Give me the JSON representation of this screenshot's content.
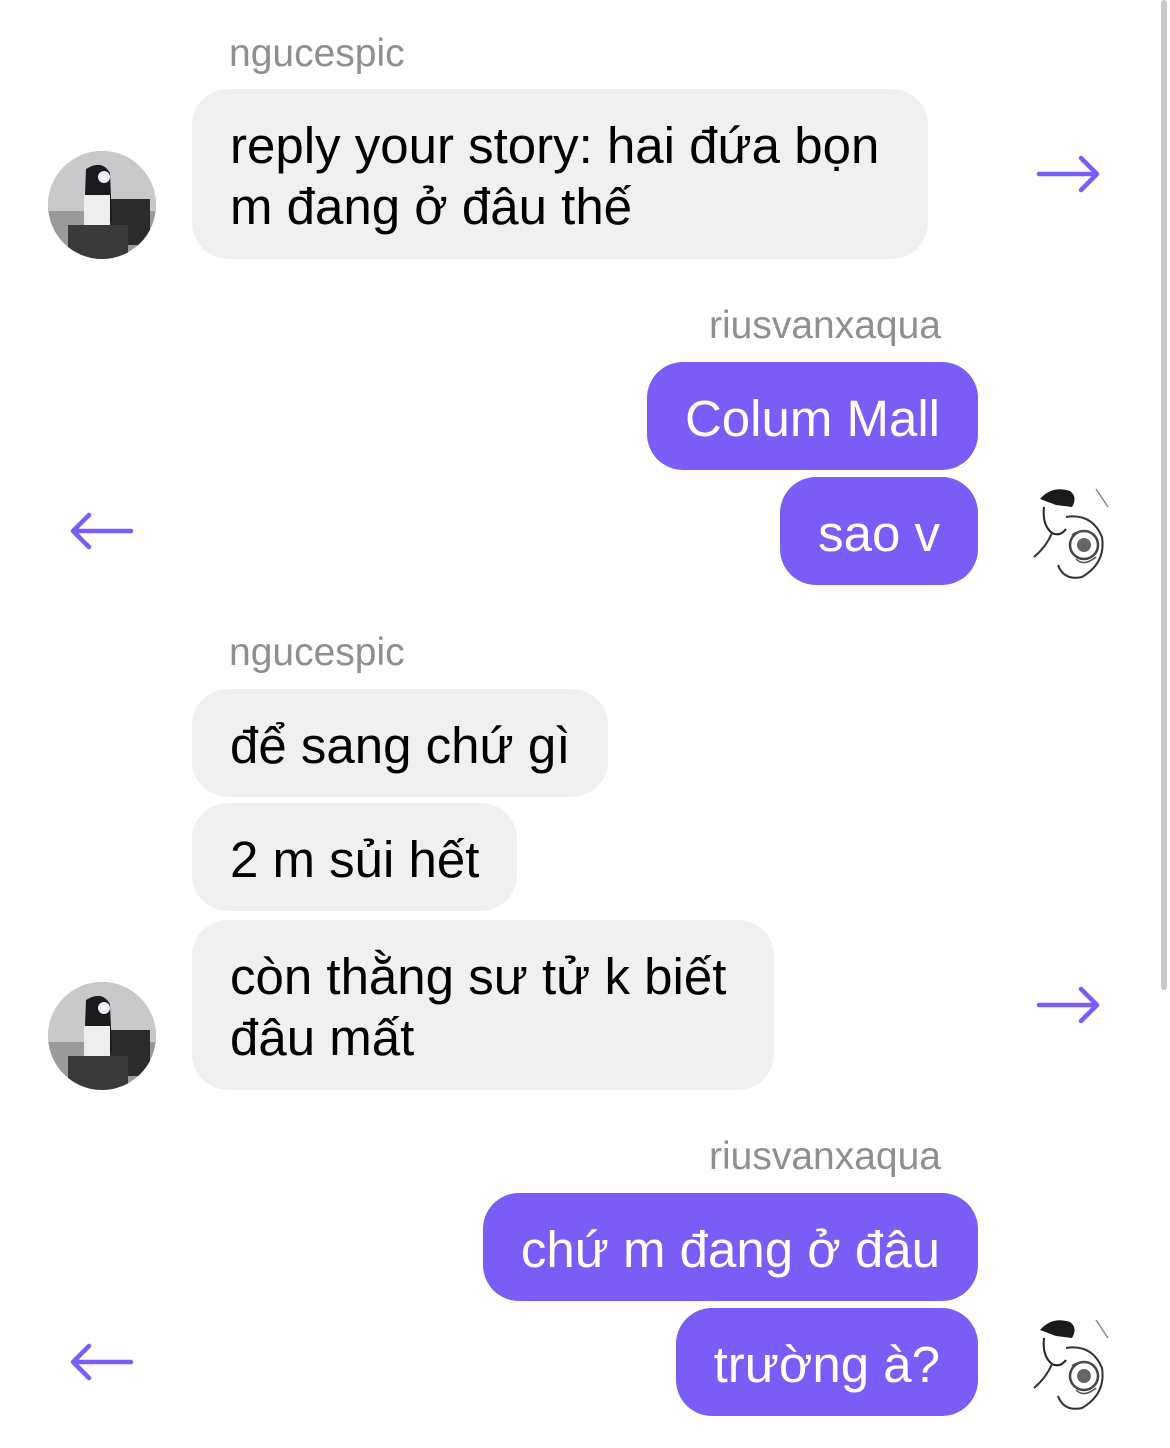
{
  "colors": {
    "accent": "#7b5cf6",
    "incoming_bubble": "#f0f0f2",
    "sender_name": "#8e8e93"
  },
  "icons": {
    "forward": "arrow-right-icon",
    "back": "arrow-left-icon"
  },
  "messages": [
    {
      "sender": "ngucespic",
      "direction": "incoming",
      "lines": [
        "reply your story: hai đứa bọn",
        "m đang ở đâu thế"
      ]
    },
    {
      "sender": "riusvanxaqua",
      "direction": "outgoing",
      "bubbles": [
        "Colum Mall",
        "sao v"
      ]
    },
    {
      "sender": "ngucespic",
      "direction": "incoming",
      "bubbles": [
        "để sang chứ gì",
        "2 m sủi hết"
      ],
      "multiline": [
        "còn thằng sư tử k biết",
        "đâu mất"
      ]
    },
    {
      "sender": "riusvanxaqua",
      "direction": "outgoing",
      "bubbles": [
        "chứ m đang ở đâu",
        "trường à?"
      ]
    }
  ]
}
